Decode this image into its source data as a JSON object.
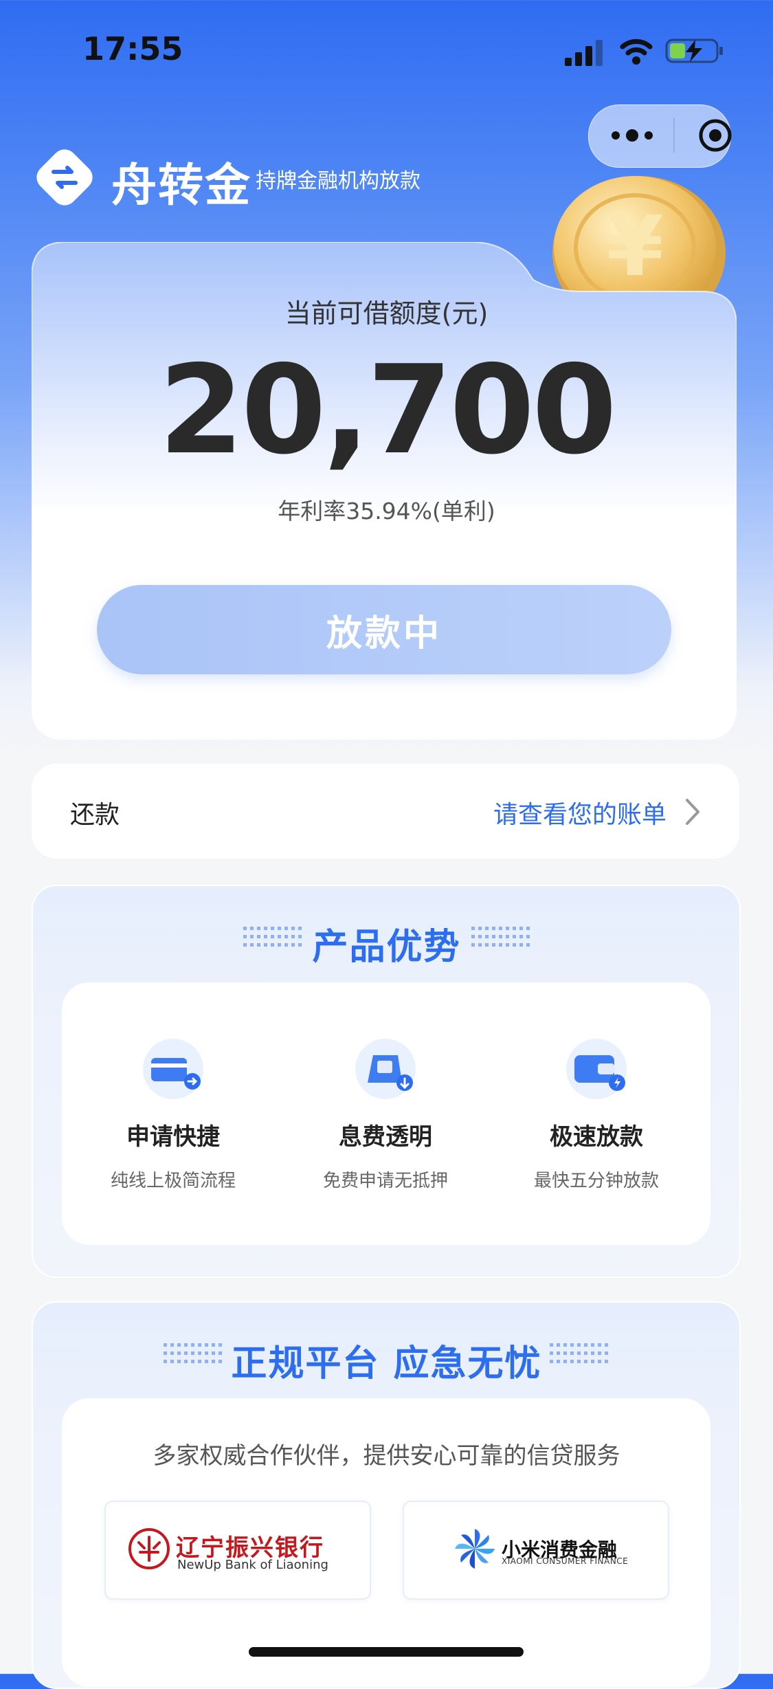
{
  "status_bar": {
    "time": "17:55"
  },
  "capsule": {
    "more_icon": "more-dots-icon",
    "close_icon": "target-icon"
  },
  "brand": {
    "name": "舟转金",
    "tagline": "持牌金融机构放款",
    "logo_icon": "swap-arrows-icon"
  },
  "quota": {
    "label": "当前可借额度(元)",
    "amount": "20,700",
    "rate": "年利率35.94%(单利)",
    "button": "放款中"
  },
  "repay": {
    "label": "还款",
    "link": "请查看您的账单"
  },
  "advantages": {
    "title": "产品优势",
    "items": [
      {
        "title": "申请快捷",
        "desc": "纯线上极简流程",
        "icon": "card-arrow-icon"
      },
      {
        "title": "息费透明",
        "desc": "免费申请无抵押",
        "icon": "wallet-down-icon"
      },
      {
        "title": "极速放款",
        "desc": "最快五分钟放款",
        "icon": "wallet-bolt-icon"
      }
    ]
  },
  "platform": {
    "title": "正规平台 应急无忧",
    "desc": "多家权威合作伙伴，提供安心可靠的信贷服务",
    "partners": [
      {
        "name": "辽宁振兴银行",
        "subname": "NewUp Bank of Liaoning",
        "icon": "bank-seal-icon"
      },
      {
        "name": "小米消费金融",
        "subname": "XIAOMI CONSUMER FINANCE",
        "icon": "pinwheel-icon"
      }
    ]
  },
  "colors": {
    "primary": "#2d6ef0",
    "header": "#2f6cf2",
    "button": "#b3cbf9"
  }
}
